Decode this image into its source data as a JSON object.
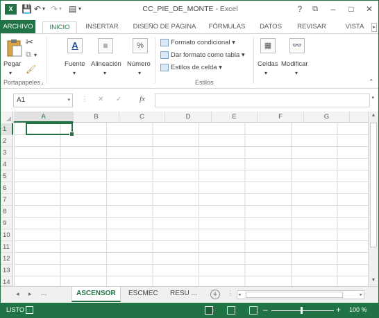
{
  "window": {
    "file_name": "CC_PIE_DE_MONTE",
    "separator": " - ",
    "app_name": "Excel",
    "help_label": "?",
    "restore_label": "⧉",
    "minimize_label": "–",
    "maximize_label": "□",
    "close_label": "✕"
  },
  "qat": {
    "save": "💾",
    "undo": "↶",
    "undo_dd": "▾",
    "redo": "↷",
    "redo_dd": "▾",
    "customize": "▤",
    "customize_dd": "▾"
  },
  "tabs": [
    {
      "label": "ARCHIVO"
    },
    {
      "label": "INICIO"
    },
    {
      "label": "INSERTAR"
    },
    {
      "label": "DISEÑO DE PÁGINA"
    },
    {
      "label": "FÓRMULAS"
    },
    {
      "label": "DATOS"
    },
    {
      "label": "REVISAR"
    },
    {
      "label": "VISTA"
    }
  ],
  "ribbon": {
    "paste_label": "Pegar",
    "font_label": "Fuente",
    "align_label": "Alineación",
    "number_label": "Número",
    "number_symbol": "%",
    "cond_format": "Formato condicional",
    "format_table": "Dar formato como tabla",
    "cell_styles": "Estilos de celda",
    "cells_label": "Celdas",
    "edit_label": "Modificar",
    "group_clipboard": "Portapapeles",
    "group_styles": "Estilos",
    "collapse_glyph": "⌃"
  },
  "formula_bar": {
    "name_box": "A1",
    "fx": "fx",
    "value": ""
  },
  "grid": {
    "columns": [
      "A",
      "B",
      "C",
      "D",
      "E",
      "F",
      "G"
    ],
    "rows": [
      "1",
      "2",
      "3",
      "4",
      "5",
      "6",
      "7",
      "8",
      "9",
      "10",
      "11",
      "12",
      "13",
      "14"
    ]
  },
  "sheets": {
    "ellipsis": "...",
    "tabs": [
      {
        "label": "ASCENSOR",
        "active": true
      },
      {
        "label": "ESCMEC",
        "active": false
      },
      {
        "label": "RESU ...",
        "active": false
      }
    ],
    "add": "+"
  },
  "status": {
    "mode": "LISTO",
    "zoom": "100 %",
    "zoom_value_percent": 100
  },
  "colors": {
    "accent": "#217346"
  }
}
